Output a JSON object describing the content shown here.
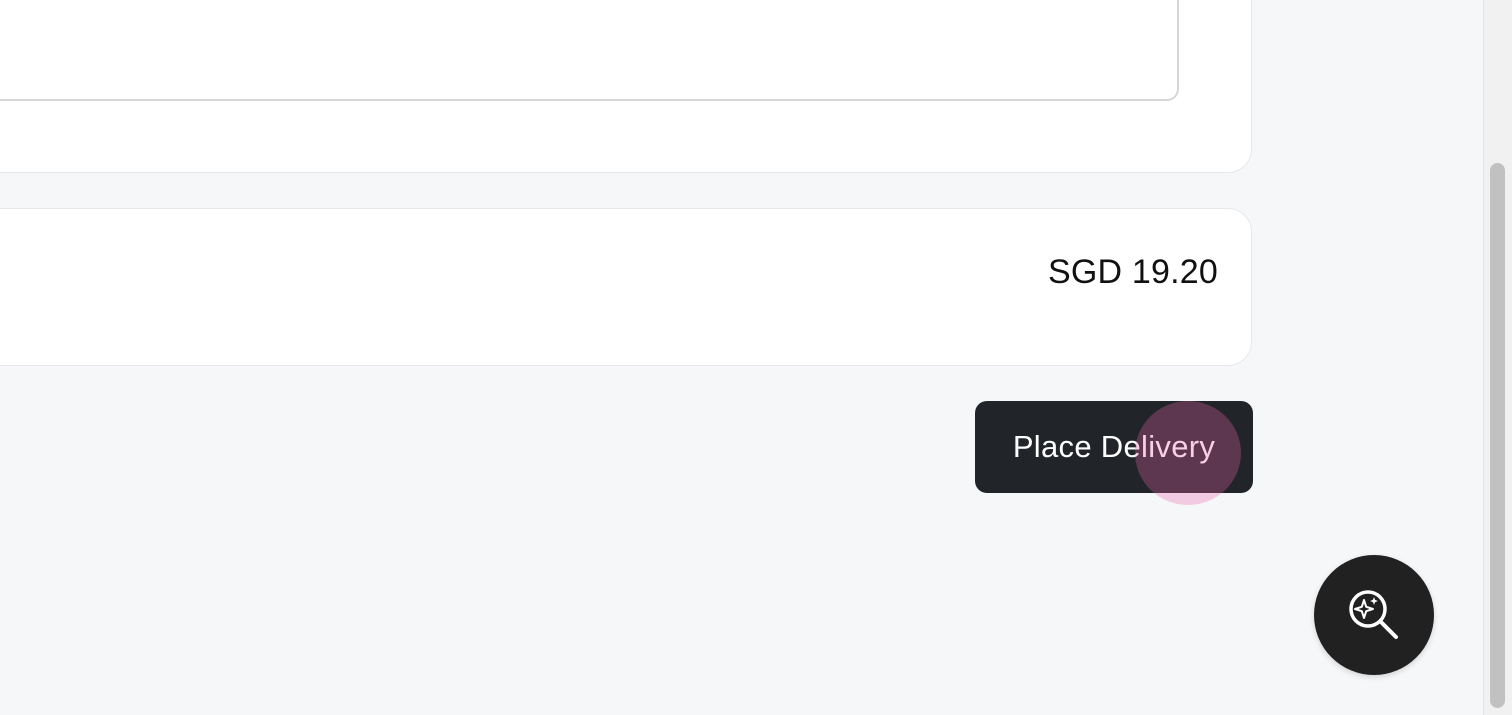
{
  "order": {
    "note_field_value": "",
    "total_amount": "SGD 19.20"
  },
  "actions": {
    "place_delivery_label": "Place Delivery"
  },
  "fab": {
    "icon": "ai-search-icon"
  },
  "colors": {
    "button_bg": "#212529",
    "page_bg": "#f6f7f9",
    "click_indicator": "#e964aa"
  }
}
